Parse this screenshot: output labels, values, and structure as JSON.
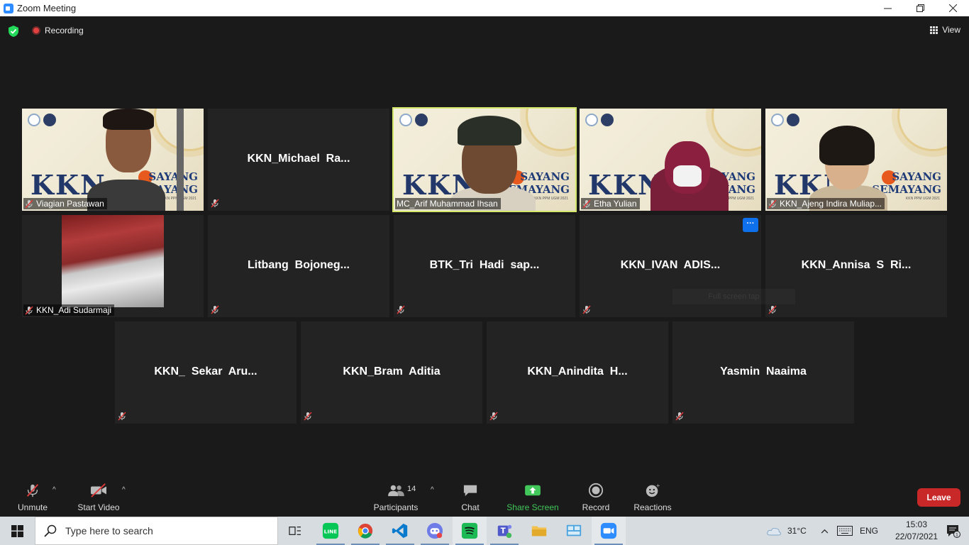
{
  "window": {
    "title": "Zoom Meeting"
  },
  "topbar": {
    "recording_label": "Recording",
    "view_label": "View"
  },
  "tiles_row1": [
    {
      "name": "Viagian Pastawan",
      "type": "video"
    },
    {
      "name": "KKN_Michael  Ra...",
      "type": "name"
    },
    {
      "name": "MC_Arif Muhammad Ihsan",
      "type": "video",
      "active": true
    },
    {
      "name": "Etha Yulian",
      "type": "video"
    },
    {
      "name": "KKN_Ajeng Indira Muliap...",
      "type": "video"
    }
  ],
  "tiles_row2": [
    {
      "name": "KKN_Adi Sudarmaji",
      "type": "flag"
    },
    {
      "name": "Litbang  Bojoneg...",
      "type": "name"
    },
    {
      "name": "BTK_Tri  Hadi  sap...",
      "type": "name"
    },
    {
      "name": "KKN_IVAN  ADIS...",
      "type": "name"
    },
    {
      "name": "KKN_Annisa  S  Ri...",
      "type": "name"
    }
  ],
  "tiles_row3": [
    {
      "name": "KKN_  Sekar  Aru...",
      "type": "name"
    },
    {
      "name": "KKN_Bram  Aditia",
      "type": "name"
    },
    {
      "name": "KKN_Anindita  H...",
      "type": "name"
    },
    {
      "name": "Yasmin  Naaima",
      "type": "name"
    }
  ],
  "video_branding": {
    "kkn": "KKN",
    "sayang_line1": "SAYANG",
    "sayang_line2": "SEMAYANG",
    "sub": "KKN PPM UGM 2021"
  },
  "more_button": "···",
  "tooltip": "Full screen tap",
  "toolbar": {
    "unmute": "Unmute",
    "start_video": "Start Video",
    "participants": "Participants",
    "participants_count": "14",
    "chat": "Chat",
    "share_screen": "Share Screen",
    "record": "Record",
    "reactions": "Reactions",
    "leave": "Leave"
  },
  "taskbar": {
    "search_placeholder": "Type here to search",
    "temperature": "31°C",
    "language": "ENG",
    "time": "15:03",
    "date": "22/07/2021",
    "notification_count": "1"
  },
  "colors": {
    "share_green": "#41c75a",
    "leave_red": "#c92828",
    "active_speaker": "#d3e86a",
    "zoom_blue": "#2d8cff"
  }
}
